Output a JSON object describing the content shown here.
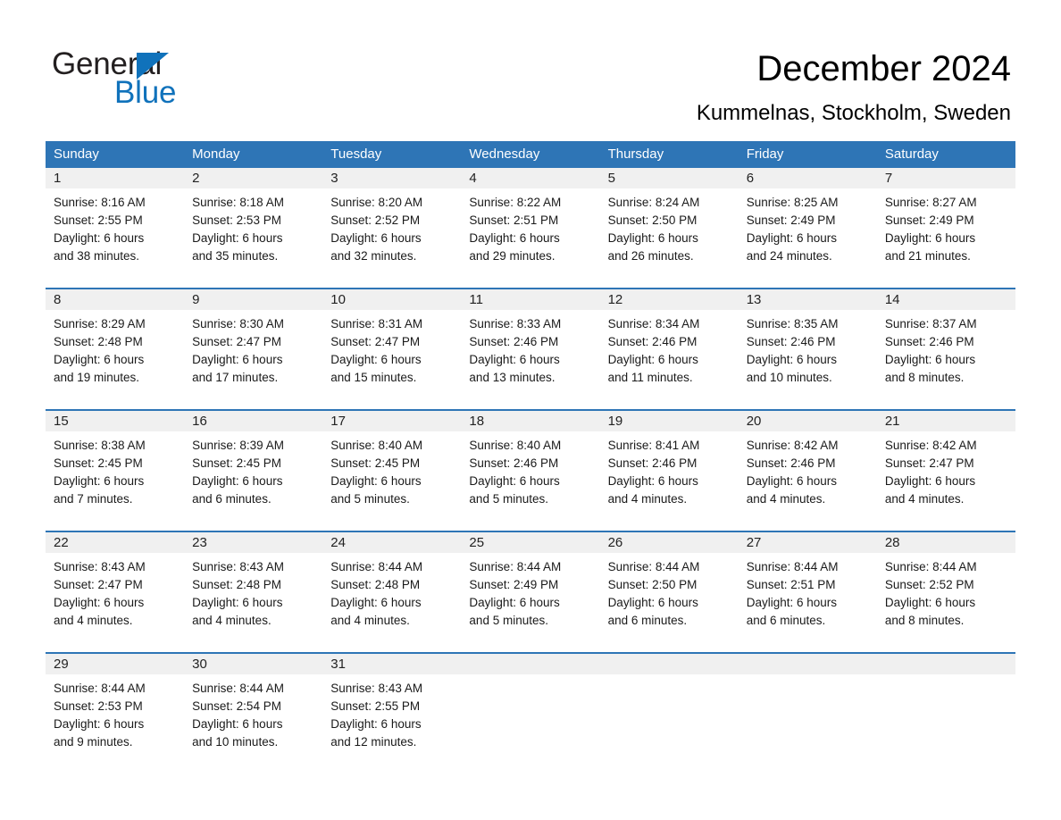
{
  "brand": {
    "name_part1": "General",
    "name_part2": "Blue",
    "triangle_color": "#1072bb"
  },
  "header": {
    "title": "December 2024",
    "location": "Kummelnas, Stockholm, Sweden"
  },
  "theme": {
    "header_bg": "#2e75b6",
    "header_text": "#ffffff",
    "daynum_band": "#f0f0f0",
    "rule": "#2e75b6"
  },
  "weekdays": [
    "Sunday",
    "Monday",
    "Tuesday",
    "Wednesday",
    "Thursday",
    "Friday",
    "Saturday"
  ],
  "weeks": [
    [
      {
        "day": "1",
        "sunrise": "Sunrise: 8:16 AM",
        "sunset": "Sunset: 2:55 PM",
        "daylight1": "Daylight: 6 hours",
        "daylight2": "and 38 minutes."
      },
      {
        "day": "2",
        "sunrise": "Sunrise: 8:18 AM",
        "sunset": "Sunset: 2:53 PM",
        "daylight1": "Daylight: 6 hours",
        "daylight2": "and 35 minutes."
      },
      {
        "day": "3",
        "sunrise": "Sunrise: 8:20 AM",
        "sunset": "Sunset: 2:52 PM",
        "daylight1": "Daylight: 6 hours",
        "daylight2": "and 32 minutes."
      },
      {
        "day": "4",
        "sunrise": "Sunrise: 8:22 AM",
        "sunset": "Sunset: 2:51 PM",
        "daylight1": "Daylight: 6 hours",
        "daylight2": "and 29 minutes."
      },
      {
        "day": "5",
        "sunrise": "Sunrise: 8:24 AM",
        "sunset": "Sunset: 2:50 PM",
        "daylight1": "Daylight: 6 hours",
        "daylight2": "and 26 minutes."
      },
      {
        "day": "6",
        "sunrise": "Sunrise: 8:25 AM",
        "sunset": "Sunset: 2:49 PM",
        "daylight1": "Daylight: 6 hours",
        "daylight2": "and 24 minutes."
      },
      {
        "day": "7",
        "sunrise": "Sunrise: 8:27 AM",
        "sunset": "Sunset: 2:49 PM",
        "daylight1": "Daylight: 6 hours",
        "daylight2": "and 21 minutes."
      }
    ],
    [
      {
        "day": "8",
        "sunrise": "Sunrise: 8:29 AM",
        "sunset": "Sunset: 2:48 PM",
        "daylight1": "Daylight: 6 hours",
        "daylight2": "and 19 minutes."
      },
      {
        "day": "9",
        "sunrise": "Sunrise: 8:30 AM",
        "sunset": "Sunset: 2:47 PM",
        "daylight1": "Daylight: 6 hours",
        "daylight2": "and 17 minutes."
      },
      {
        "day": "10",
        "sunrise": "Sunrise: 8:31 AM",
        "sunset": "Sunset: 2:47 PM",
        "daylight1": "Daylight: 6 hours",
        "daylight2": "and 15 minutes."
      },
      {
        "day": "11",
        "sunrise": "Sunrise: 8:33 AM",
        "sunset": "Sunset: 2:46 PM",
        "daylight1": "Daylight: 6 hours",
        "daylight2": "and 13 minutes."
      },
      {
        "day": "12",
        "sunrise": "Sunrise: 8:34 AM",
        "sunset": "Sunset: 2:46 PM",
        "daylight1": "Daylight: 6 hours",
        "daylight2": "and 11 minutes."
      },
      {
        "day": "13",
        "sunrise": "Sunrise: 8:35 AM",
        "sunset": "Sunset: 2:46 PM",
        "daylight1": "Daylight: 6 hours",
        "daylight2": "and 10 minutes."
      },
      {
        "day": "14",
        "sunrise": "Sunrise: 8:37 AM",
        "sunset": "Sunset: 2:46 PM",
        "daylight1": "Daylight: 6 hours",
        "daylight2": "and 8 minutes."
      }
    ],
    [
      {
        "day": "15",
        "sunrise": "Sunrise: 8:38 AM",
        "sunset": "Sunset: 2:45 PM",
        "daylight1": "Daylight: 6 hours",
        "daylight2": "and 7 minutes."
      },
      {
        "day": "16",
        "sunrise": "Sunrise: 8:39 AM",
        "sunset": "Sunset: 2:45 PM",
        "daylight1": "Daylight: 6 hours",
        "daylight2": "and 6 minutes."
      },
      {
        "day": "17",
        "sunrise": "Sunrise: 8:40 AM",
        "sunset": "Sunset: 2:45 PM",
        "daylight1": "Daylight: 6 hours",
        "daylight2": "and 5 minutes."
      },
      {
        "day": "18",
        "sunrise": "Sunrise: 8:40 AM",
        "sunset": "Sunset: 2:46 PM",
        "daylight1": "Daylight: 6 hours",
        "daylight2": "and 5 minutes."
      },
      {
        "day": "19",
        "sunrise": "Sunrise: 8:41 AM",
        "sunset": "Sunset: 2:46 PM",
        "daylight1": "Daylight: 6 hours",
        "daylight2": "and 4 minutes."
      },
      {
        "day": "20",
        "sunrise": "Sunrise: 8:42 AM",
        "sunset": "Sunset: 2:46 PM",
        "daylight1": "Daylight: 6 hours",
        "daylight2": "and 4 minutes."
      },
      {
        "day": "21",
        "sunrise": "Sunrise: 8:42 AM",
        "sunset": "Sunset: 2:47 PM",
        "daylight1": "Daylight: 6 hours",
        "daylight2": "and 4 minutes."
      }
    ],
    [
      {
        "day": "22",
        "sunrise": "Sunrise: 8:43 AM",
        "sunset": "Sunset: 2:47 PM",
        "daylight1": "Daylight: 6 hours",
        "daylight2": "and 4 minutes."
      },
      {
        "day": "23",
        "sunrise": "Sunrise: 8:43 AM",
        "sunset": "Sunset: 2:48 PM",
        "daylight1": "Daylight: 6 hours",
        "daylight2": "and 4 minutes."
      },
      {
        "day": "24",
        "sunrise": "Sunrise: 8:44 AM",
        "sunset": "Sunset: 2:48 PM",
        "daylight1": "Daylight: 6 hours",
        "daylight2": "and 4 minutes."
      },
      {
        "day": "25",
        "sunrise": "Sunrise: 8:44 AM",
        "sunset": "Sunset: 2:49 PM",
        "daylight1": "Daylight: 6 hours",
        "daylight2": "and 5 minutes."
      },
      {
        "day": "26",
        "sunrise": "Sunrise: 8:44 AM",
        "sunset": "Sunset: 2:50 PM",
        "daylight1": "Daylight: 6 hours",
        "daylight2": "and 6 minutes."
      },
      {
        "day": "27",
        "sunrise": "Sunrise: 8:44 AM",
        "sunset": "Sunset: 2:51 PM",
        "daylight1": "Daylight: 6 hours",
        "daylight2": "and 6 minutes."
      },
      {
        "day": "28",
        "sunrise": "Sunrise: 8:44 AM",
        "sunset": "Sunset: 2:52 PM",
        "daylight1": "Daylight: 6 hours",
        "daylight2": "and 8 minutes."
      }
    ],
    [
      {
        "day": "29",
        "sunrise": "Sunrise: 8:44 AM",
        "sunset": "Sunset: 2:53 PM",
        "daylight1": "Daylight: 6 hours",
        "daylight2": "and 9 minutes."
      },
      {
        "day": "30",
        "sunrise": "Sunrise: 8:44 AM",
        "sunset": "Sunset: 2:54 PM",
        "daylight1": "Daylight: 6 hours",
        "daylight2": "and 10 minutes."
      },
      {
        "day": "31",
        "sunrise": "Sunrise: 8:43 AM",
        "sunset": "Sunset: 2:55 PM",
        "daylight1": "Daylight: 6 hours",
        "daylight2": "and 12 minutes."
      },
      {
        "day": "",
        "sunrise": "",
        "sunset": "",
        "daylight1": "",
        "daylight2": ""
      },
      {
        "day": "",
        "sunrise": "",
        "sunset": "",
        "daylight1": "",
        "daylight2": ""
      },
      {
        "day": "",
        "sunrise": "",
        "sunset": "",
        "daylight1": "",
        "daylight2": ""
      },
      {
        "day": "",
        "sunrise": "",
        "sunset": "",
        "daylight1": "",
        "daylight2": ""
      }
    ]
  ]
}
